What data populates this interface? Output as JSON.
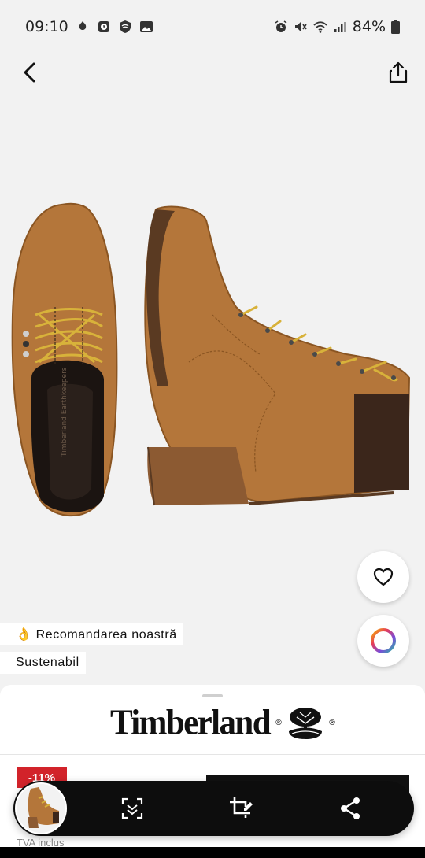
{
  "status_bar": {
    "time": "09:10",
    "battery": "84%",
    "left_icons": [
      "notification-icon",
      "clock-app-icon",
      "shield-icon",
      "gallery-icon"
    ],
    "right_icons": [
      "alarm-icon",
      "mute-icon",
      "wifi-icon",
      "signal-icon",
      "battery-icon"
    ]
  },
  "nav": {
    "back_icon": "chevron-left-icon",
    "share_icon": "share-upload-icon"
  },
  "carousel": {
    "dots": 3,
    "active_index": 1
  },
  "actions": {
    "wishlist_icon": "heart-icon",
    "color_icon": "color-wheel-icon"
  },
  "tags": {
    "recommendation": "👌 Recomandarea noastră",
    "sustainable": "Sustenabil"
  },
  "product": {
    "brand": "Timberland",
    "discount": "-11%",
    "tax_note": "TVA inclus"
  },
  "toolbar": {
    "icons": [
      "visual-search-icon",
      "crop-search-icon",
      "share-icon"
    ]
  },
  "colors": {
    "accent_red": "#d2232a",
    "boot_wheat": "#b4763a",
    "toolbar_bg": "#0d0d0d"
  }
}
